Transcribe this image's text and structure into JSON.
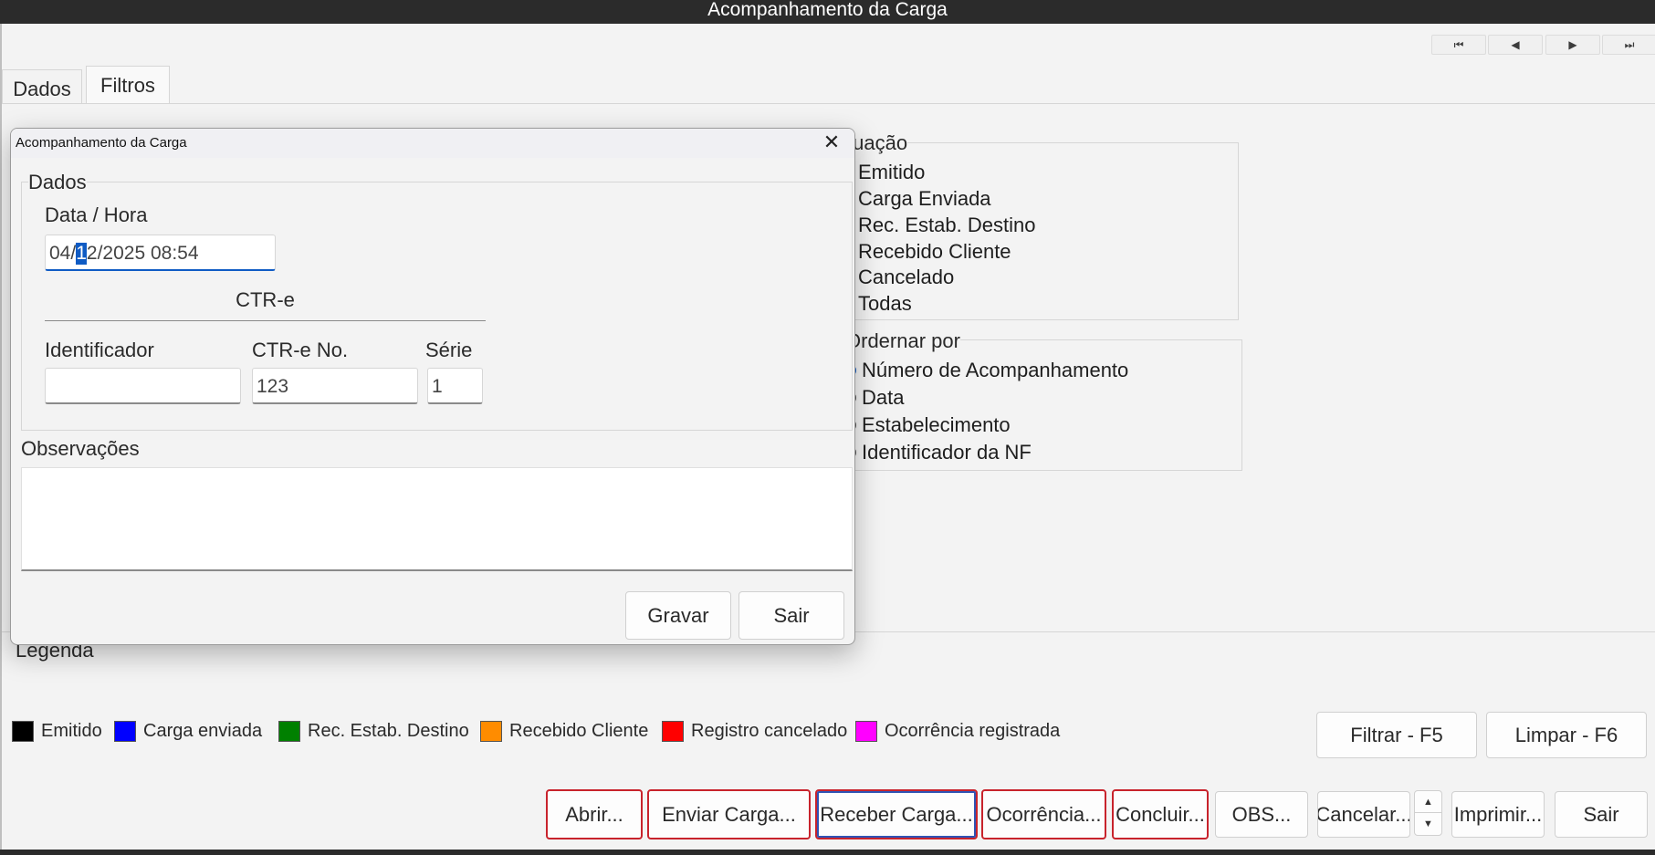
{
  "window": {
    "title": "Acompanhamento da Carga"
  },
  "nav": {
    "first": "⏮",
    "prev": "◀",
    "next": "▶",
    "last": "⏭"
  },
  "tabs": [
    {
      "label": "Dados"
    },
    {
      "label": "Filtros"
    }
  ],
  "situacao": {
    "label": "tuação",
    "options": [
      {
        "label": "Emitido"
      },
      {
        "label": "Carga Enviada"
      },
      {
        "label": "Rec. Estab. Destino"
      },
      {
        "label": "Recebido Cliente"
      },
      {
        "label": "Cancelado"
      },
      {
        "label": "Todas"
      }
    ]
  },
  "ordenar": {
    "label": "Ordernar por",
    "selected": "Número de Acompanhamento",
    "options": [
      {
        "label": "Número de Acompanhamento"
      },
      {
        "label": "Data"
      },
      {
        "label": "Estabelecimento"
      },
      {
        "label": "Identificador da NF"
      }
    ]
  },
  "legenda": {
    "label": "Legenda",
    "items": [
      {
        "label": "Emitido",
        "color": "#000000"
      },
      {
        "label": "Carga enviada",
        "color": "#0000ff"
      },
      {
        "label": "Rec. Estab. Destino",
        "color": "#008000"
      },
      {
        "label": "Recebido Cliente",
        "color": "#ff8c00"
      },
      {
        "label": "Registro cancelado",
        "color": "#ff0000"
      },
      {
        "label": "Ocorrência registrada",
        "color": "#ff00ff"
      }
    ]
  },
  "filter_buttons": {
    "filtrar": "Filtrar - F5",
    "limpar": "Limpar - F6"
  },
  "toolbar": {
    "abrir": "Abrir...",
    "enviar": "Enviar Carga...",
    "receber": "Receber Carga...",
    "ocorrencia": "Ocorrência...",
    "concluir": "Concluir...",
    "obs": "OBS...",
    "cancelar": "Cancelar...",
    "imprimir": "Imprimir...",
    "sair": "Sair"
  },
  "dialog": {
    "title": "Acompanhamento da Carga",
    "close": "✕",
    "group_label": "Dados",
    "datetime_label": "Data / Hora",
    "datetime_before": "04/",
    "datetime_selected": "1",
    "datetime_after": "2/2025 08:54",
    "ctre_header": "CTR-e",
    "identificador_label": "Identificador",
    "identificador_value": "",
    "ctre_no_label": "CTR-e No.",
    "ctre_no_value": "123",
    "serie_label": "Série",
    "serie_value": "1",
    "observacoes_label": "Observações",
    "gravar": "Gravar",
    "sair": "Sair"
  },
  "colors": {
    "accent": "#0f5bc4",
    "highlight_border": "#c8232c"
  }
}
